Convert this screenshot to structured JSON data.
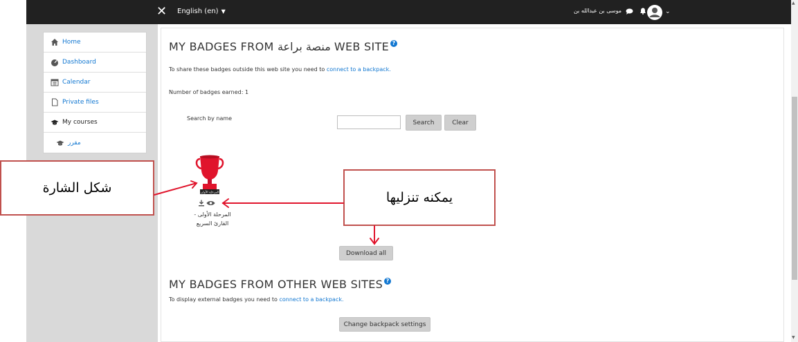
{
  "topbar": {
    "language": "English (en)",
    "user_name": "موسى بن عبدالله بن خميس بن سالم السلطي طالب",
    "icons": [
      "close-icon",
      "caret-down-icon",
      "bell-icon",
      "chat-icon",
      "avatar-icon",
      "chevron-down-icon"
    ]
  },
  "nav": {
    "items": [
      {
        "label": "Home",
        "icon": "home-icon"
      },
      {
        "label": "Dashboard",
        "icon": "dashboard-icon"
      },
      {
        "label": "Calendar",
        "icon": "calendar-icon"
      },
      {
        "label": "Private files",
        "icon": "file-icon"
      },
      {
        "label": "My courses",
        "icon": "graduation-cap-icon"
      },
      {
        "label": "مقرر",
        "icon": "graduation-cap-icon"
      }
    ]
  },
  "main": {
    "title_prefix": "MY BADGES FROM ",
    "title_site": "منصة براعة",
    "title_suffix": " WEB SITE",
    "share_text": "To share these badges outside this web site you need to ",
    "share_link": "connect to a backpack.",
    "badges_earned": "Number of badges earned: 1",
    "search_label": "Search by name",
    "search_value": "",
    "search_button": "Search",
    "clear_button": "Clear",
    "badge": {
      "image_text": "المرحلة الأولى",
      "name": "المرحلة الأولى - القارئ السريع"
    },
    "download_all": "Download all",
    "other_title": "MY BADGES FROM OTHER WEB SITES",
    "external_text": "To display external badges you need to ",
    "external_link": "connect to a backpack.",
    "change_backpack": "Change backpack settings"
  },
  "annotations": {
    "badge_shape": "شكل الشارة",
    "can_download": "يمكنه تنزليها"
  },
  "colors": {
    "topbar": "#212121",
    "link": "#1177d1",
    "annotation_border": "#c0504d",
    "arrow": "#e0142c"
  }
}
